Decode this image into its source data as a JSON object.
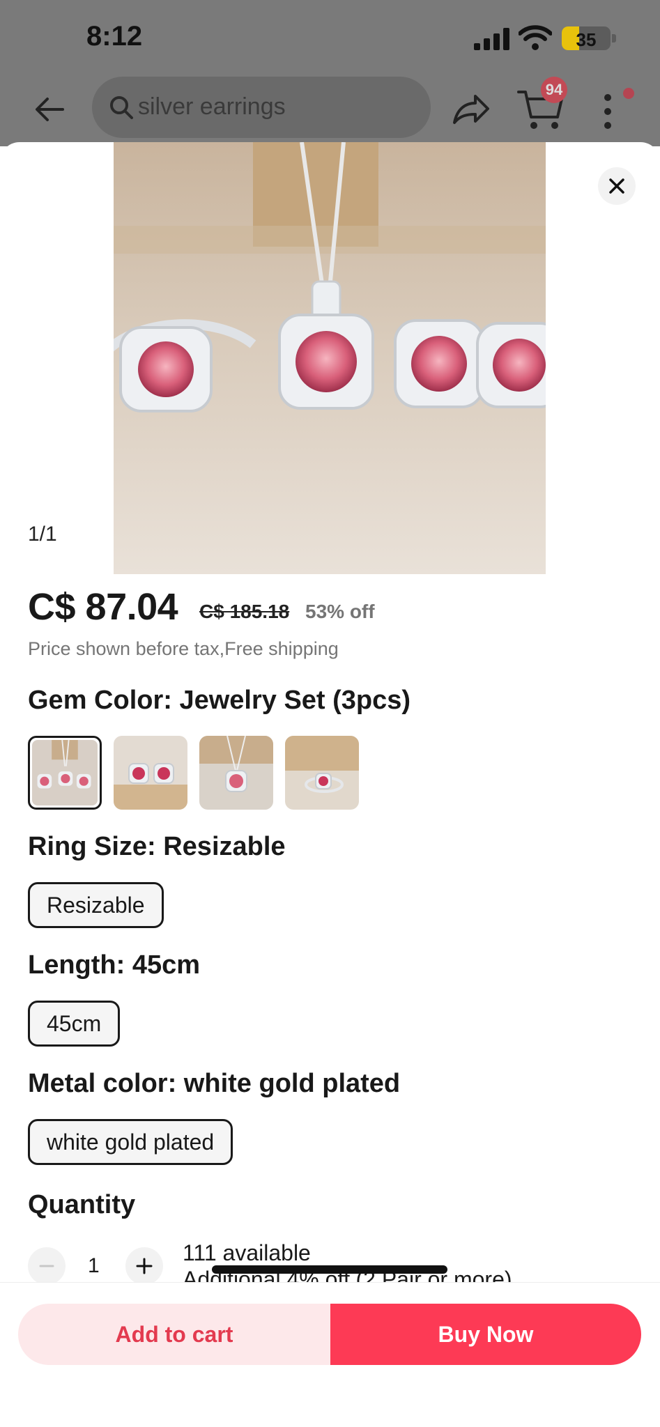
{
  "status_bar": {
    "time": "8:12",
    "battery": "35",
    "battery_level": 0.35
  },
  "top_bar": {
    "search_text": "silver earrings",
    "cart_badge": "94",
    "icons": [
      "back-arrow-icon",
      "search-icon",
      "share-icon",
      "cart-icon",
      "more-vertical-icon"
    ]
  },
  "product": {
    "image_counter": "1/1",
    "price": "C$ 87.04",
    "original_price": "C$ 185.18",
    "discount": "53% off",
    "price_note": "Price shown before tax,Free shipping"
  },
  "options": {
    "gem_color": {
      "label": "Gem Color: Jewelry Set (3pcs)",
      "swatches": [
        "jewelry-set-3pcs",
        "earrings",
        "necklace",
        "ring"
      ],
      "selected_index": 0
    },
    "ring_size": {
      "label": "Ring Size: Resizable",
      "chip": "Resizable"
    },
    "length": {
      "label": "Length: 45cm",
      "chip": "45cm"
    },
    "metal_color": {
      "label": "Metal color: white gold plated",
      "chip": "white gold plated"
    }
  },
  "quantity": {
    "label": "Quantity",
    "value": "1",
    "available": "111 available",
    "promo": "Additional 4% off (2 Pair or more)"
  },
  "actions": {
    "add_to_cart": "Add to cart",
    "buy_now": "Buy Now"
  },
  "colors": {
    "accent": "#fd3a55",
    "accent_light": "#fde8ea",
    "badge": "#c24a55"
  }
}
